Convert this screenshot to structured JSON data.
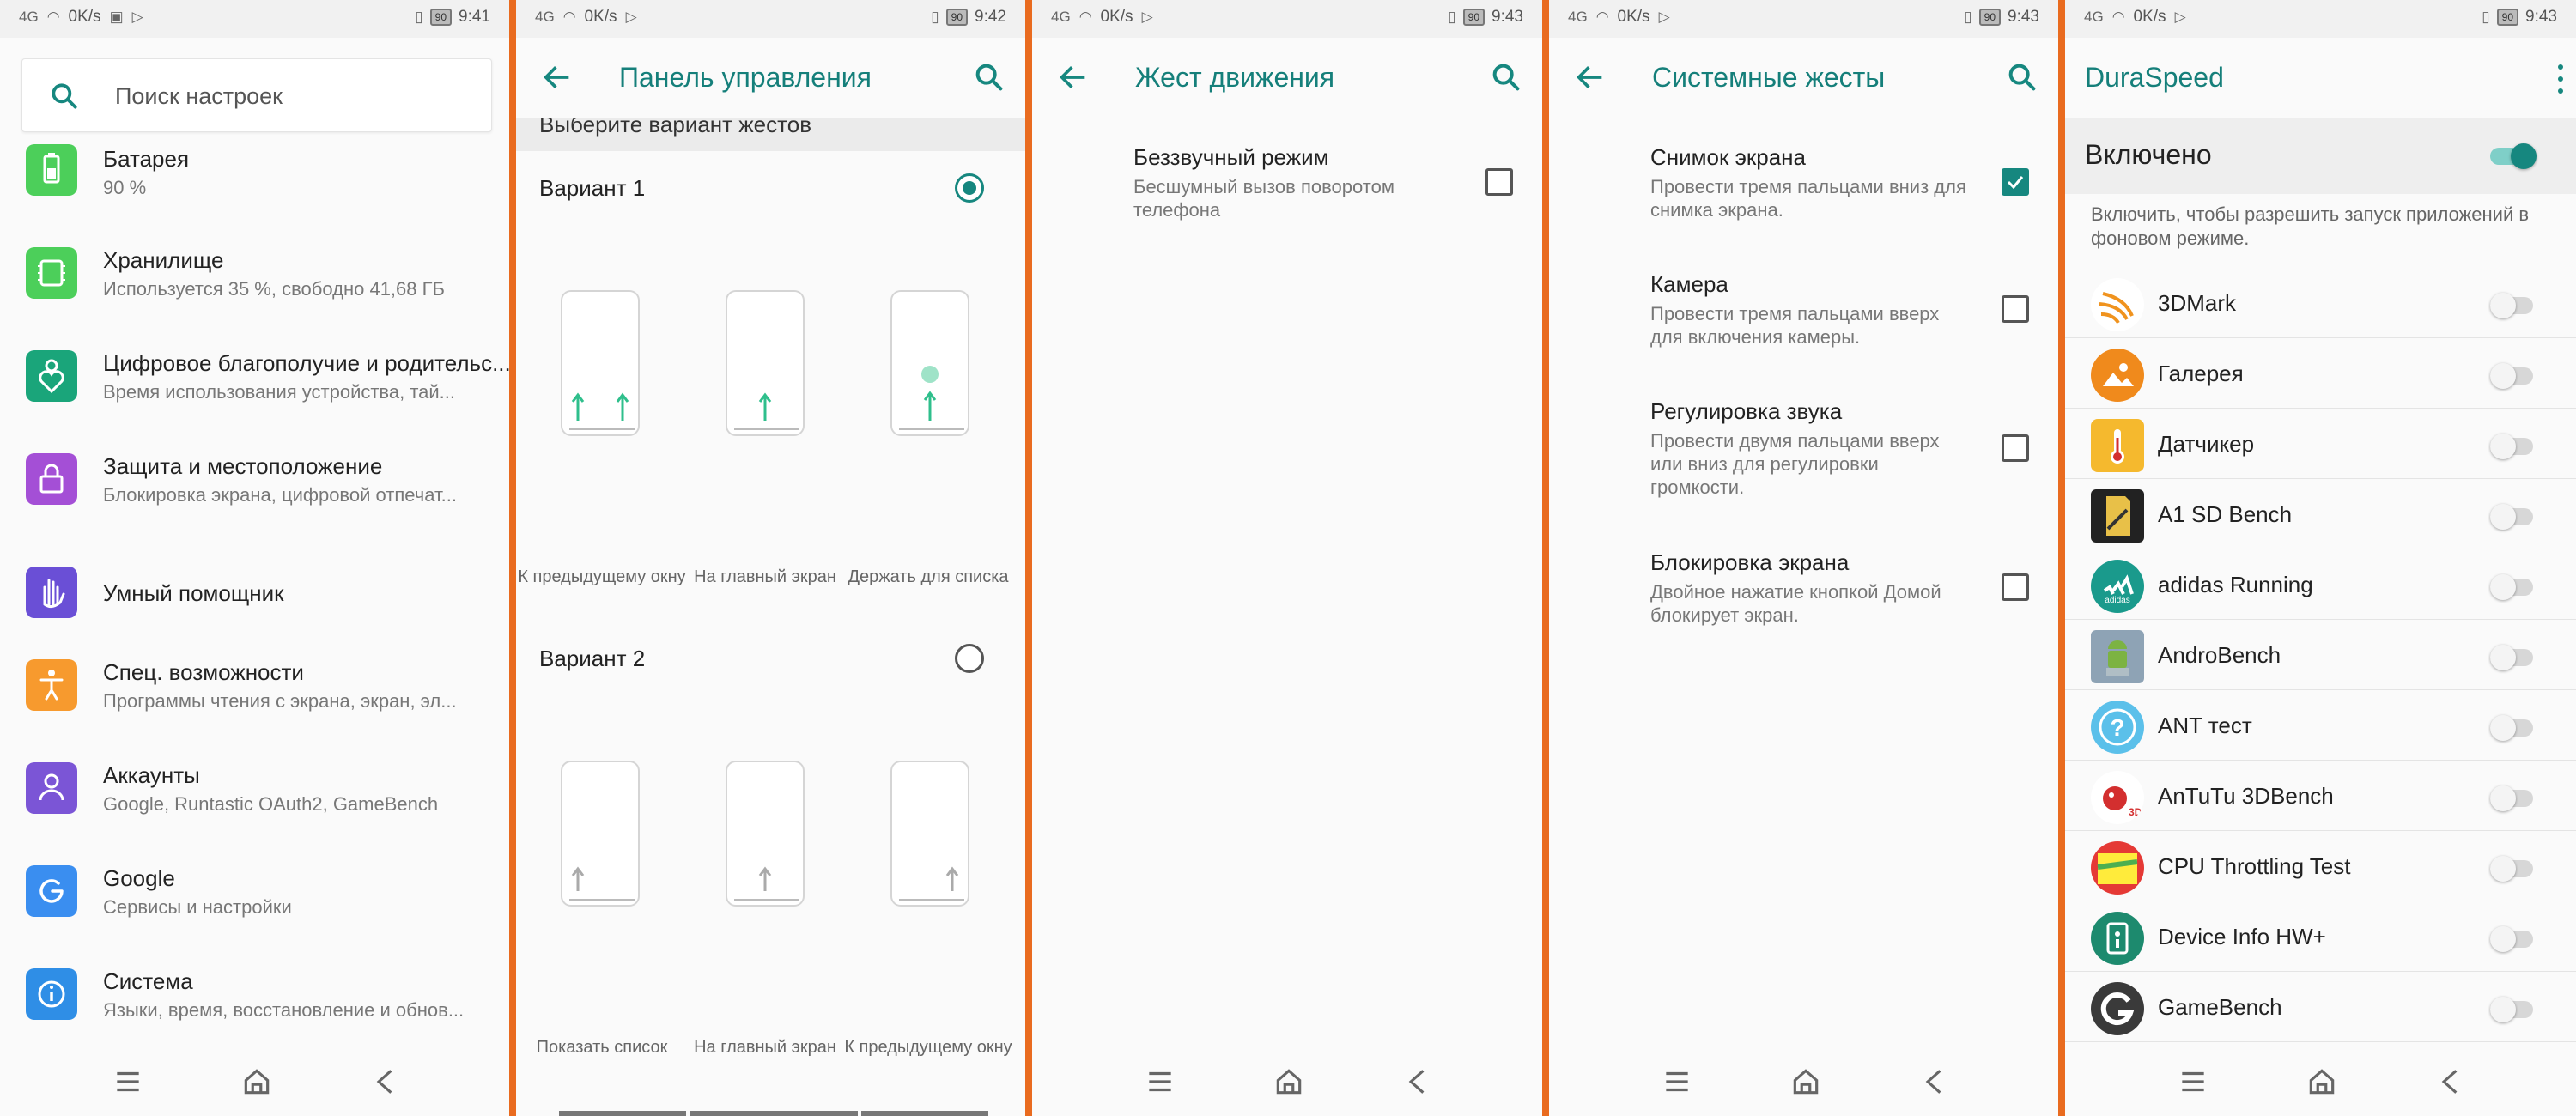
{
  "colors": {
    "accent": "#16877f",
    "title": "#157f7a",
    "divider": "#e96b1f"
  },
  "panels": [
    {
      "status": {
        "net": "4G",
        "speed": "0K/s",
        "battery": "90",
        "time": "9:41"
      },
      "search": {
        "placeholder": "Поиск настроек"
      },
      "items": [
        {
          "icon": "battery-icon",
          "title": "Батарея",
          "sub": "90 %"
        },
        {
          "icon": "storage-icon",
          "title": "Хранилище",
          "sub": "Используется 35 %, свободно 41,68 ГБ"
        },
        {
          "icon": "wellbeing-icon",
          "title": "Цифровое благополучие и родительс...",
          "sub": "Время использования устройства, тай..."
        },
        {
          "icon": "lock-icon",
          "title": "Защита и местоположение",
          "sub": "Блокировка экрана, цифровой отпечат..."
        },
        {
          "icon": "hand-icon",
          "title": "Умный помощник",
          "sub": ""
        },
        {
          "icon": "accessibility-icon",
          "title": "Спец. возможности",
          "sub": "Программы чтения с экрана, экран, эл..."
        },
        {
          "icon": "account-icon",
          "title": "Аккаунты",
          "sub": "Google, Runtastic OAuth2, GameBench"
        },
        {
          "icon": "google-icon",
          "title": "Google",
          "sub": "Сервисы и настройки"
        },
        {
          "icon": "info-icon",
          "title": "Система",
          "sub": "Языки, время, восстановление и обнов..."
        }
      ]
    },
    {
      "status": {
        "net": "4G",
        "speed": "0K/s",
        "battery": "90",
        "time": "9:42"
      },
      "title": "Панель управления",
      "scroll_hint": "Выберите вариант жестов",
      "variants": [
        {
          "label": "Вариант 1",
          "selected": true,
          "captions": [
            "К предыдущему окну",
            "На главный экран",
            "Держать для списка"
          ]
        },
        {
          "label": "Вариант 2",
          "selected": false,
          "captions": [
            "Показать список",
            "На главный экран",
            "К предыдущему окну"
          ]
        }
      ]
    },
    {
      "status": {
        "net": "4G",
        "speed": "0K/s",
        "battery": "90",
        "time": "9:43"
      },
      "title": "Жест движения",
      "items": [
        {
          "title": "Беззвучный режим",
          "sub": "Бесшумный вызов поворотом телефона",
          "checked": false
        }
      ]
    },
    {
      "status": {
        "net": "4G",
        "speed": "0K/s",
        "battery": "90",
        "time": "9:43"
      },
      "title": "Системные жесты",
      "items": [
        {
          "title": "Снимок экрана",
          "sub": "Провести тремя пальцами вниз для снимка экрана.",
          "checked": true
        },
        {
          "title": "Камера",
          "sub": "Провести тремя пальцами вверх для включения камеры.",
          "checked": false
        },
        {
          "title": "Регулировка звука",
          "sub": "Провести двумя пальцами вверх или вниз для регулировки громкости.",
          "checked": false
        },
        {
          "title": "Блокировка экрана",
          "sub": "Двойное нажатие кнопкой Домой блокирует экран.",
          "checked": false
        }
      ]
    },
    {
      "status": {
        "net": "4G",
        "speed": "0K/s",
        "battery": "90",
        "time": "9:43"
      },
      "title": "DuraSpeed",
      "enabled_label": "Включено",
      "enabled": true,
      "description": "Включить, чтобы разрешить запуск приложений в фоновом режиме.",
      "apps": [
        {
          "name": "3DMark",
          "icon": "3dmark-icon",
          "on": false
        },
        {
          "name": "Галерея",
          "icon": "gallery-icon",
          "on": false
        },
        {
          "name": "Датчикер",
          "icon": "thermometer-icon",
          "on": false
        },
        {
          "name": "A1 SD Bench",
          "icon": "sd-card-icon",
          "on": false
        },
        {
          "name": "adidas Running",
          "icon": "adidas-icon",
          "on": false
        },
        {
          "name": "AndroBench",
          "icon": "android-icon",
          "on": false
        },
        {
          "name": "ANT тест",
          "icon": "ant-icon",
          "on": false
        },
        {
          "name": "AnTuTu 3DBench",
          "icon": "antutu-icon",
          "on": false
        },
        {
          "name": "CPU Throttling Test",
          "icon": "cpu-chart-icon",
          "on": false
        },
        {
          "name": "Device Info HW+",
          "icon": "device-info-icon",
          "on": false
        },
        {
          "name": "GameBench",
          "icon": "gamebench-icon",
          "on": false
        }
      ]
    }
  ]
}
